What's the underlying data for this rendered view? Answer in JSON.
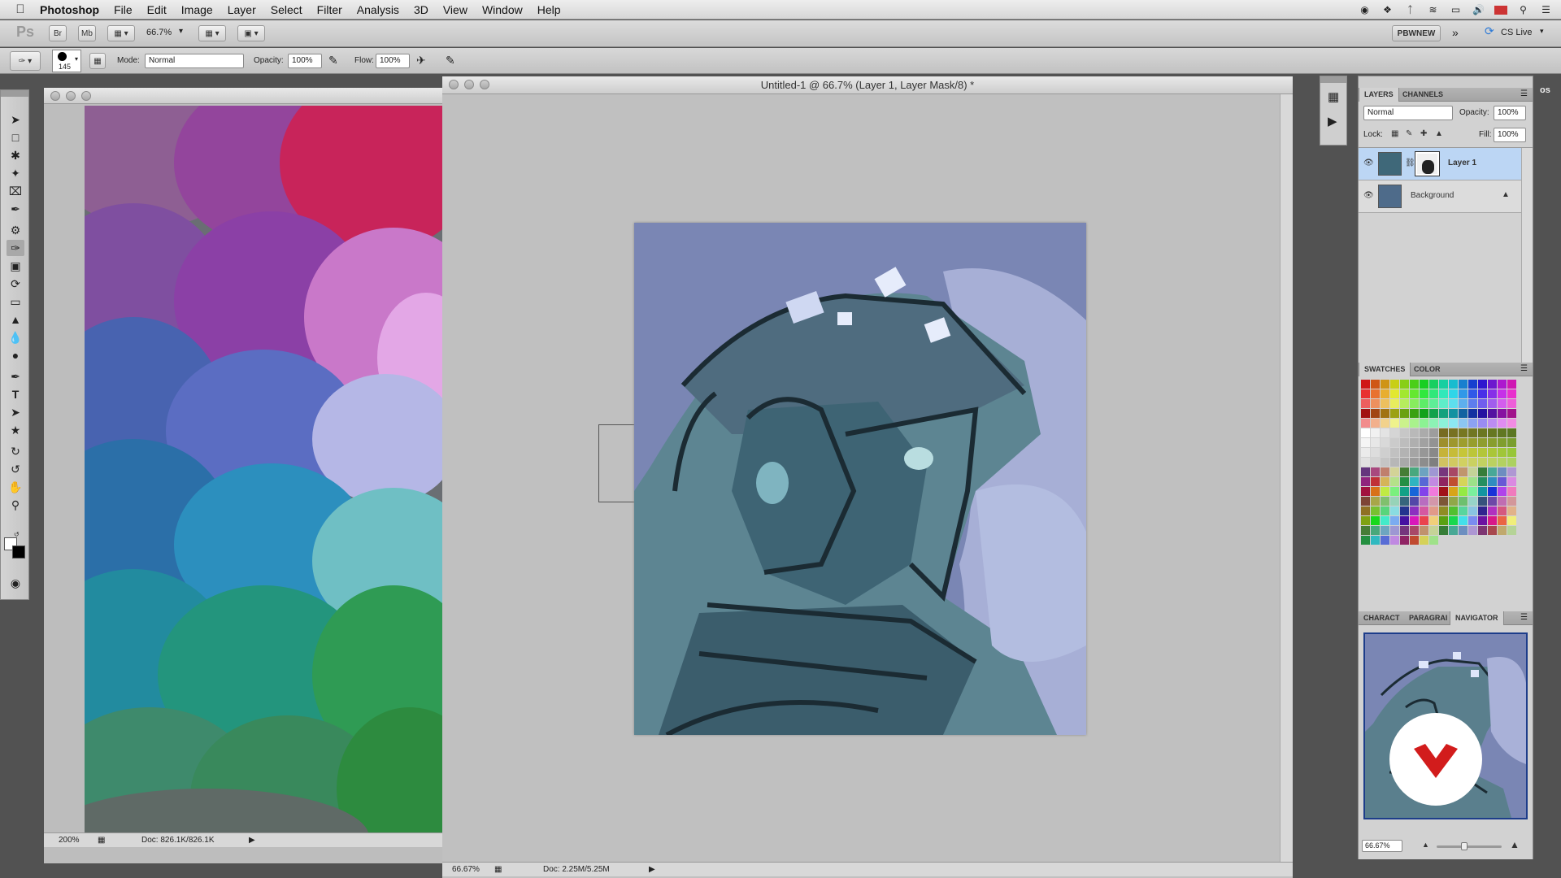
{
  "menubar": {
    "app": "Photoshop",
    "items": [
      "File",
      "Edit",
      "Image",
      "Layer",
      "Select",
      "Filter",
      "Analysis",
      "3D",
      "View",
      "Window",
      "Help"
    ]
  },
  "appbar": {
    "logo": "Ps",
    "br": "Br",
    "mb": "Mb",
    "zoom": "66.7%",
    "workspace": "PBWNEW",
    "cslive": "CS Live"
  },
  "options": {
    "brush_size": "145",
    "mode_label": "Mode:",
    "mode_value": "Normal",
    "opacity_label": "Opacity:",
    "opacity_value": "100%",
    "flow_label": "Flow:",
    "flow_value": "100%"
  },
  "doc_left": {
    "zoom": "200%",
    "docsize": "Doc: 826.1K/826.1K"
  },
  "doc_main": {
    "title": "Untitled-1 @ 66.7% (Layer 1, Layer Mask/8) *",
    "zoom": "66.67%",
    "docsize": "Doc: 2.25M/5.25M"
  },
  "layers_panel": {
    "tabs": [
      "LAYERS",
      "CHANNELS"
    ],
    "blend_mode": "Normal",
    "opacity_label": "Opacity:",
    "opacity_value": "100%",
    "lock_label": "Lock:",
    "fill_label": "Fill:",
    "fill_value": "100%",
    "layers": [
      {
        "name": "Layer 1",
        "selected": true
      },
      {
        "name": "Background",
        "selected": false
      }
    ]
  },
  "swatches_panel": {
    "tabs": [
      "SWATCHES",
      "COLOR"
    ]
  },
  "navigator_panel": {
    "tabs": [
      "CHARACT",
      "PARAGRAI",
      "NAVIGATOR"
    ],
    "zoom": "66.67%"
  },
  "colors": {
    "accent_selected": "#bcd6f4",
    "canvas_bg": "#c0c0c0",
    "watermark_red": "#d21c1c"
  }
}
